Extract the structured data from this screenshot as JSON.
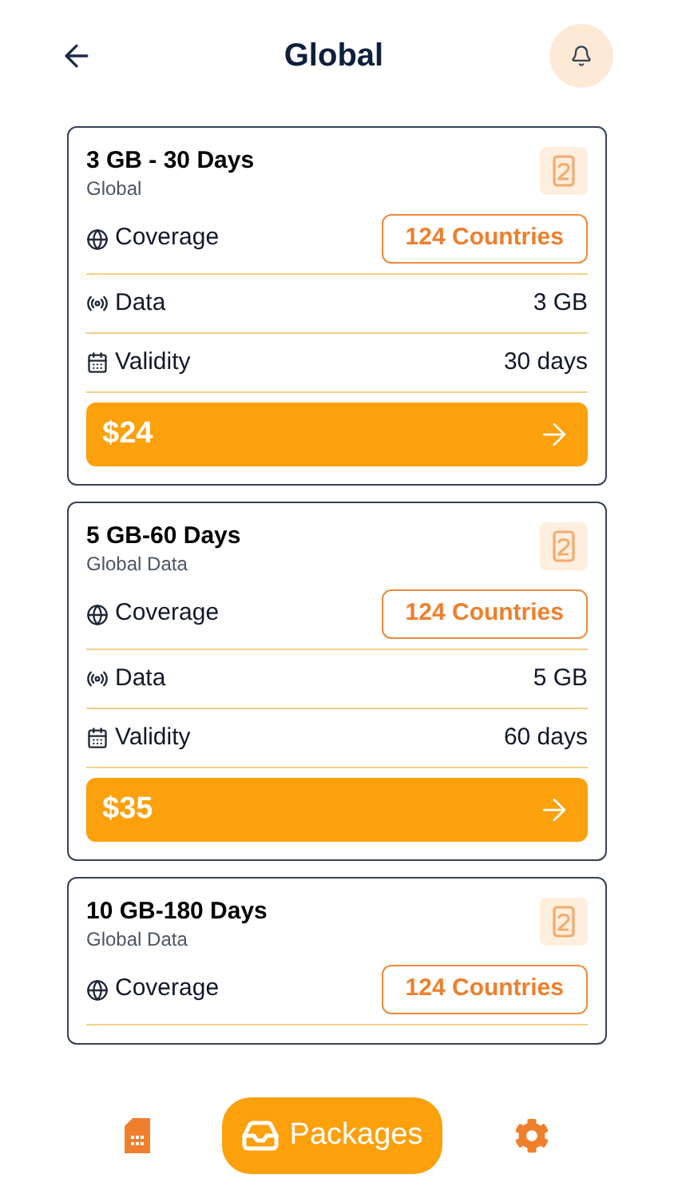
{
  "header": {
    "title": "Global"
  },
  "packages": [
    {
      "title": "3 GB - 30 Days",
      "subtitle": "Global",
      "rows": [
        {
          "kind": "coverage",
          "label": "Coverage",
          "value": "124 Countries"
        },
        {
          "kind": "data",
          "label": "Data",
          "value": "3 GB"
        },
        {
          "kind": "validity",
          "label": "Validity",
          "value": "30 days"
        }
      ],
      "price": "$24"
    },
    {
      "title": "5 GB-60 Days",
      "subtitle": "Global Data",
      "rows": [
        {
          "kind": "coverage",
          "label": "Coverage",
          "value": "124 Countries"
        },
        {
          "kind": "data",
          "label": "Data",
          "value": "5 GB"
        },
        {
          "kind": "validity",
          "label": "Validity",
          "value": "60 days"
        }
      ],
      "price": "$35"
    },
    {
      "title": "10 GB-180 Days",
      "subtitle": "Global Data",
      "rows": [
        {
          "kind": "coverage",
          "label": "Coverage",
          "value": "124 Countries"
        }
      ]
    }
  ],
  "nav": [
    {
      "kind": "sim",
      "selected": false
    },
    {
      "kind": "packages",
      "label": "Packages",
      "selected": true
    },
    {
      "kind": "settings",
      "selected": false
    }
  ]
}
